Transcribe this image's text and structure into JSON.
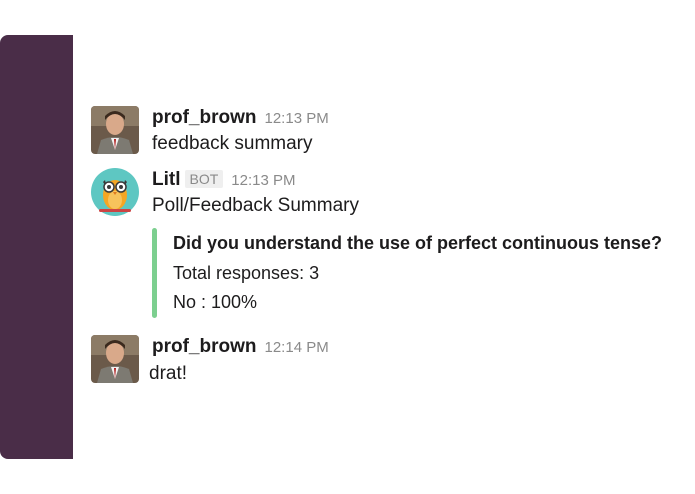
{
  "sidebar": {
    "color": "#4a2d48"
  },
  "messages": [
    {
      "username": "prof_brown",
      "timestamp": "12:13 PM",
      "text": "feedback summary",
      "avatar": "user-photo-avatar"
    },
    {
      "username": "Litl",
      "badge": "BOT",
      "timestamp": "12:13 PM",
      "text": "Poll/Feedback Summary",
      "avatar": "owl-icon",
      "attachment": {
        "accent_color": "#7ccf8f",
        "title": "Did you understand the use of perfect continuous tense?",
        "total": "Total responses: 3",
        "result": "No : 100%"
      }
    },
    {
      "username": "prof_brown",
      "timestamp": "12:14 PM",
      "text": "drat!",
      "avatar": "user-photo-avatar"
    }
  ]
}
